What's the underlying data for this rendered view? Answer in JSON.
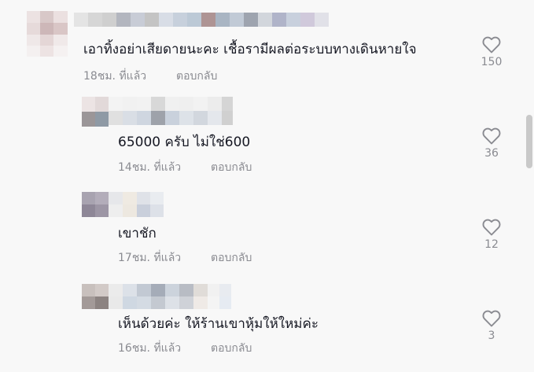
{
  "comments": [
    {
      "text": "เอาทิ้งอย่าเสียดายนะคะ เชื้อรามีผลต่อระบบทางเดินหายใจ",
      "time": "18ชม. ที่แล้ว",
      "reply_label": "ตอบกลับ",
      "likes": "150"
    },
    {
      "text": "65000 ครับ ไม่ใช่600",
      "time": "14ชม. ที่แล้ว",
      "reply_label": "ตอบกลับ",
      "likes": "36"
    },
    {
      "text": "เขาชัก",
      "time": "17ชม. ที่แล้ว",
      "reply_label": "ตอบกลับ",
      "likes": "12"
    },
    {
      "text": "เห็นด้วยค่ะ ให้ร้านเขาหุ้มให้ใหม่ค่ะ",
      "time": "16ชม. ที่แล้ว",
      "reply_label": "ตอบกลับ",
      "likes": "3"
    }
  ],
  "icons": {
    "like": "heart-outline-icon",
    "redaction": "pixelated-blur"
  },
  "colors": {
    "background": "#f8f8f8",
    "text": "#161823",
    "secondary_text": "#8a8b91",
    "icon": "#8a8b91",
    "scrollbar": "#c9c9c9"
  }
}
